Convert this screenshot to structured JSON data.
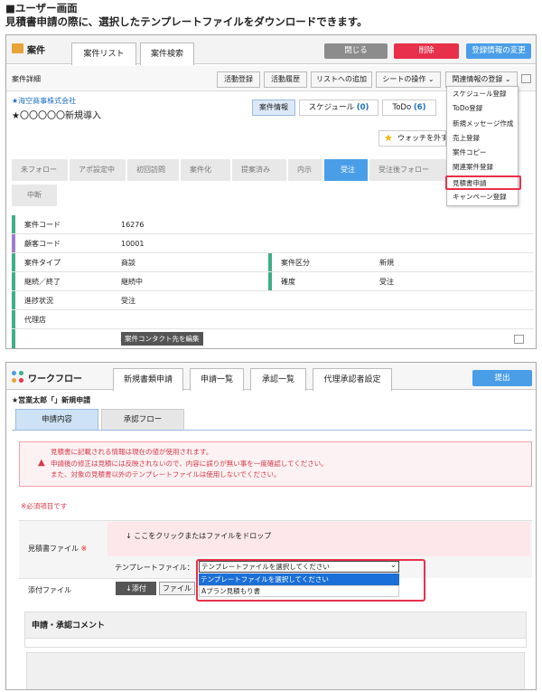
{
  "header": {
    "title": "■ユーザー画面",
    "subtitle": "見積書申請の際に、選択したテンプレートファイルをダウンロードできます。"
  },
  "case": {
    "app_title": "案件",
    "tabs": [
      "案件リスト",
      "案件検索"
    ],
    "top_buttons": {
      "close": "閉じる",
      "delete": "削除",
      "change": "登録情報の変更"
    },
    "detail_label": "案件詳細",
    "toolbar": [
      "活動登録",
      "活動履歴",
      "リストへの追加",
      "シートの操作 ⌄",
      "関連情報の登録 ⌄"
    ],
    "company": "★海空商事株式会社",
    "case_name": "★〇〇〇〇〇新規導入",
    "info_tabs": [
      {
        "label": "案件情報",
        "count": ""
      },
      {
        "label": "スケジュール",
        "count": "(0)"
      },
      {
        "label": "ToDo",
        "count": "(6)"
      }
    ],
    "watch": "ウォッチを外す",
    "steps": [
      "未フォロー",
      "アポ設定中",
      "初回訪問",
      "案件化",
      "提案済み",
      "内示",
      "受注",
      "受注後フォロー"
    ],
    "step_interrupted": "中断",
    "fields": [
      {
        "label": "案件コード",
        "value": "16276"
      },
      {
        "label": "顧客コード",
        "value": "10001"
      },
      {
        "label": "案件タイプ",
        "value": "商談",
        "label2": "案件区分",
        "value2": "新規"
      },
      {
        "label": "継続／終了",
        "value": "継続中",
        "label2": "確度",
        "value2": "受注"
      },
      {
        "label": "進捗状況",
        "value": "受注"
      },
      {
        "label": "代理店",
        "value": ""
      }
    ],
    "edit_contact": "案件コンタクト先を編集",
    "menu": [
      "スケジュール登録",
      "ToDo登録",
      "新規メッセージ作成",
      "売上登録",
      "案件コピー",
      "関連案件登録",
      "見積書申請",
      "キャンペーン登録"
    ],
    "colors": {
      "accent": "#4a9ee8",
      "delete": "#e8304a",
      "close": "#8c8c8c",
      "highlight": "#e8304a"
    }
  },
  "workflow": {
    "app_title": "ワークフロー",
    "tabs": [
      "新規書類申請",
      "申請一覧",
      "承認一覧",
      "代理承認者設定"
    ],
    "submit": "提出",
    "applicant": "★営業太郎「」新規申請",
    "sub_tabs": [
      "申請内容",
      "承認フロー"
    ],
    "warning": [
      "見積書に記載される情報は現在の値が使用されます。",
      "申請後の修正は見積には反映されないので、内容に誤りが無い事を一度確認してください。",
      "また、対象の見積書以外のテンプレートファイルは使用しないでください。"
    ],
    "required_note": "※必須項目です",
    "estimate_label": "見積書ファイル",
    "required_mark": "※",
    "drop_text": "↓ ここをクリックまたはファイルをドロップ",
    "template_label": "テンプレートファイル：",
    "template_select": "テンプレートファイルを選択してください",
    "template_options": [
      "テンプレートファイルを選択してください",
      "Aプラン見積もり書"
    ],
    "attach_label": "添付ファイル",
    "attach_button": "↓添付",
    "file_button": "ファイル",
    "comment_title": "申請・承認コメント"
  }
}
